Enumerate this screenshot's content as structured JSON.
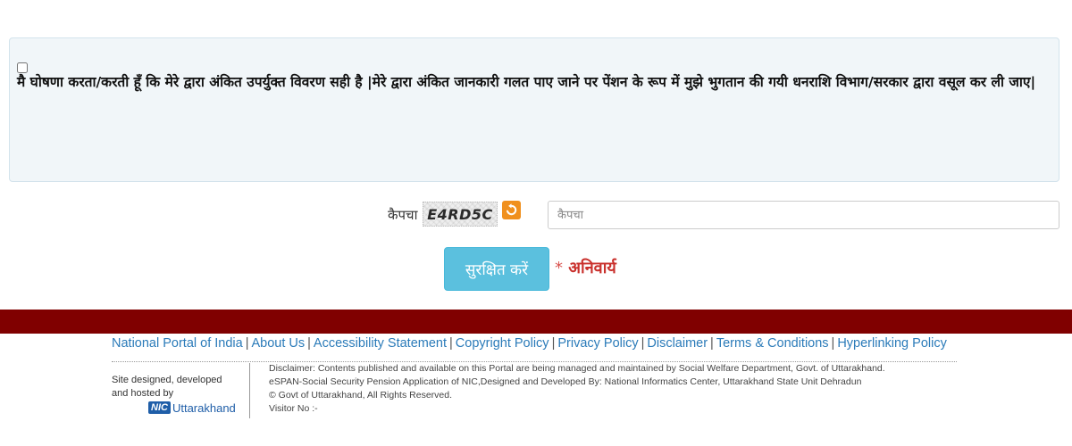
{
  "declaration": {
    "text": "मै घोषणा करता/करती हूँ कि मेरे द्वारा अंकित उपर्युक्त विवरण सही है |मेरे द्वारा अंकित जानकारी गलत पाए जाने पर पेंशन के रूप में मुझे भुगतान की गयी धनराशि विभाग/सरकार द्वारा वसूल कर ली जाए|"
  },
  "captcha": {
    "label": "कैपचा",
    "code": "E4RD5C",
    "refresh_icon": "refresh-icon",
    "placeholder": "कैपचा"
  },
  "form": {
    "save_label": "सुरक्षित करें",
    "mandatory_star": "*",
    "mandatory_label": "अनिवार्य"
  },
  "colors": {
    "footer_bar": "#800000",
    "save_button": "#5bc0de",
    "link": "#2b7bb9",
    "mandatory": "#c9302c",
    "refresh": "#f0901e"
  },
  "footer": {
    "links": [
      "National Portal of India",
      "About Us",
      "Accessibility Statement",
      "Copyright Policy",
      "Privacy Policy",
      "Disclaimer",
      "Terms & Conditions",
      "Hyperlinking Policy"
    ],
    "credit_line1": "Site designed, developed",
    "credit_line2": "and hosted by",
    "nic_badge": "NIC",
    "nic_text": "Uttarakhand",
    "disclaimer_lines": [
      "Disclaimer: Contents published and available on this Portal are being managed and maintained by Social Welfare Department, Govt. of Uttarakhand.",
      "eSPAN-Social Security Pension Application of NIC,Designed and Developed By: National Informatics Center, Uttarakhand State Unit Dehradun",
      "© Govt of Uttarakhand, All Rights Reserved.",
      "Visitor No :-"
    ]
  }
}
